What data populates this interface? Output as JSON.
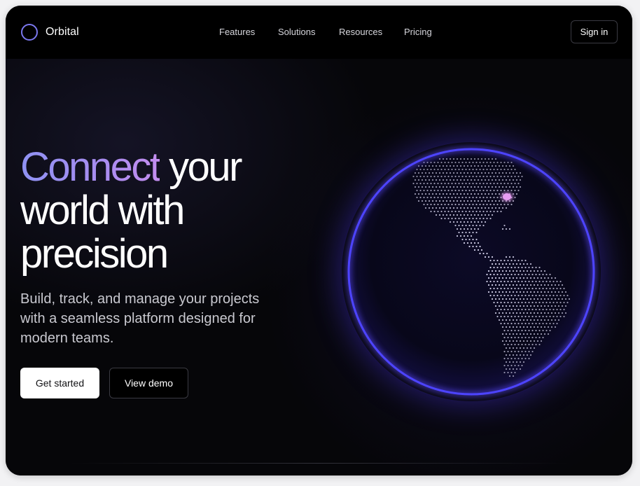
{
  "brand": {
    "name": "Orbital",
    "logo_icon": "ring-icon",
    "accent_color": "#7b78ee"
  },
  "nav": {
    "links": [
      "Features",
      "Solutions",
      "Resources",
      "Pricing"
    ],
    "sign_in_label": "Sign in"
  },
  "hero": {
    "headline_accent": "Connect",
    "headline_rest_line1": " your",
    "headline_line2": "world with",
    "headline_line3": "precision",
    "subtext": "Build, track, and manage your projects with a seamless platform designed for modern teams.",
    "primary_cta": "Get started",
    "secondary_cta": "View demo"
  },
  "globe": {
    "icon": "globe-icon",
    "glow_color": "#5a4cff",
    "dot_color": "#e8e6ff",
    "marker_color": "#e79cf2"
  }
}
